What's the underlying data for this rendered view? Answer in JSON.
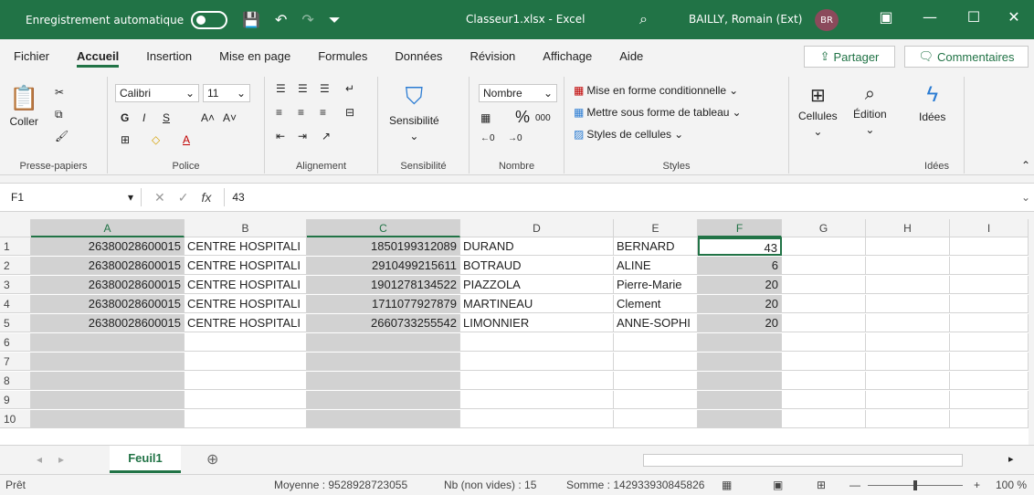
{
  "titlebar": {
    "autosave_label": "Enregistrement automatique",
    "doc_title": "Classeur1.xlsx  -  Excel",
    "user_name": "BAILLY, Romain (Ext)",
    "avatar_initials": "BR"
  },
  "menu": {
    "items": [
      "Fichier",
      "Accueil",
      "Insertion",
      "Mise en page",
      "Formules",
      "Données",
      "Révision",
      "Affichage",
      "Aide"
    ],
    "active": "Accueil",
    "share_label": "Partager",
    "comments_label": "Commentaires"
  },
  "ribbon": {
    "clipboard": {
      "paste_label": "Coller",
      "group_label": "Presse-papiers"
    },
    "font": {
      "font_name": "Calibri",
      "font_size": "11",
      "group_label": "Police",
      "bold": "G",
      "italic": "I",
      "underline": "S"
    },
    "alignment": {
      "group_label": "Alignement"
    },
    "sensitivity": {
      "button_label": "Sensibilité",
      "group_label": "Sensibilité"
    },
    "number": {
      "format": "Nombre",
      "percent": "%",
      "thousands": "000",
      "group_label": "Nombre"
    },
    "styles": {
      "conditional": "Mise en forme conditionnelle",
      "table": "Mettre sous forme de tableau",
      "cell_styles": "Styles de cellules",
      "group_label": "Styles"
    },
    "cells": {
      "button_label": "Cellules"
    },
    "edition": {
      "button_label": "Édition"
    },
    "ideas": {
      "button_label": "Idées",
      "group_label": "Idées"
    }
  },
  "formula_bar": {
    "name_box": "F1",
    "value": "43"
  },
  "grid": {
    "columns": [
      "A",
      "B",
      "C",
      "D",
      "E",
      "F",
      "G",
      "H",
      "I"
    ],
    "row_numbers": [
      "1",
      "2",
      "3",
      "4",
      "5",
      "6",
      "7",
      "8",
      "9",
      "10"
    ],
    "rows": [
      [
        "26380028600015",
        "CENTRE HOSPITALI",
        "1850199312089",
        "DURAND",
        "BERNARD",
        "43"
      ],
      [
        "26380028600015",
        "CENTRE HOSPITALI",
        "2910499215611",
        "BOTRAUD",
        "ALINE",
        "6"
      ],
      [
        "26380028600015",
        "CENTRE HOSPITALI",
        "1901278134522",
        "PIAZZOLA",
        "Pierre-Marie",
        "20"
      ],
      [
        "26380028600015",
        "CENTRE HOSPITALI",
        "1711077927879",
        "MARTINEAU",
        "Clement",
        "20"
      ],
      [
        "26380028600015",
        "CENTRE HOSPITALI",
        "2660733255542",
        "LIMONNIER",
        "ANNE-SOPHI",
        "20"
      ]
    ],
    "selected_columns": [
      "A",
      "C",
      "F"
    ],
    "active_cell": "F1"
  },
  "sheets": {
    "active": "Feuil1"
  },
  "status": {
    "ready": "Prêt",
    "average": "Moyenne : 9528928723055",
    "count": "Nb (non vides) : 15",
    "sum": "Somme : 142933930845826",
    "zoom": "100 %"
  }
}
